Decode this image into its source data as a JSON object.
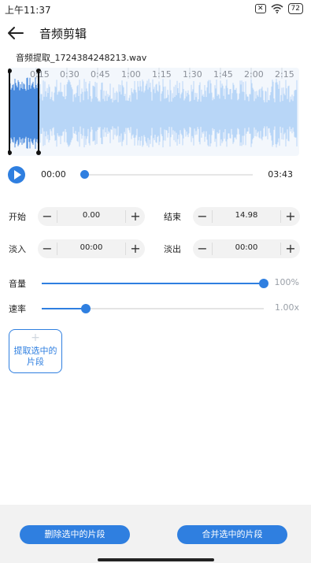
{
  "status": {
    "time": "上午11:37",
    "battery": "72",
    "sim": "✕"
  },
  "header": {
    "title": "音频剪辑"
  },
  "file": {
    "name": "音频提取_1724384248213.wav"
  },
  "timeline": {
    "ticks": [
      "0:15",
      "0:30",
      "0:45",
      "1:00",
      "1:15",
      "1:30",
      "1:45",
      "2:00",
      "2:15"
    ]
  },
  "player": {
    "current": "00:00",
    "total": "03:43",
    "progress": 0.0
  },
  "trim": {
    "start_label": "开始",
    "start_value": "0.00",
    "end_label": "结束",
    "end_value": "14.98",
    "fadein_label": "淡入",
    "fadein_value": "00:00",
    "fadeout_label": "淡出",
    "fadeout_value": "00:00",
    "minus": "−",
    "plus": "+"
  },
  "volume": {
    "label": "音量",
    "value_text": "100%",
    "level": 1.0
  },
  "speed": {
    "label": "速率",
    "value_text": "1.00x",
    "level": 0.2
  },
  "extract": {
    "plus": "+",
    "label": "提取选中的片段"
  },
  "actions": {
    "delete_label": "删除选中的片段",
    "merge_label": "合并选中的片段"
  },
  "colors": {
    "accent": "#2f7fe0",
    "wave_selected": "#1d6fd6",
    "wave": "#a9cdf5"
  }
}
